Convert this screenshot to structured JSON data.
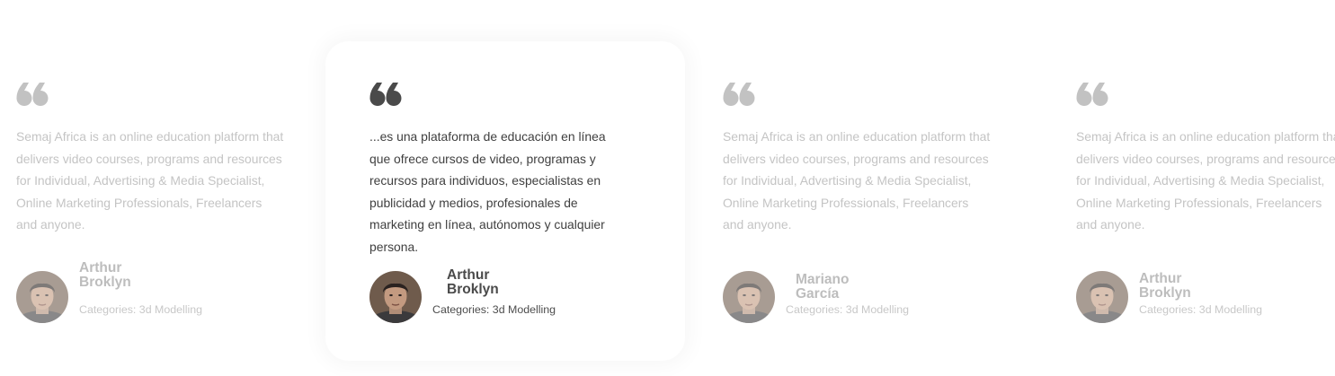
{
  "testimonials": [
    {
      "text": "Semaj Africa is an online education platform that delivers video courses, programs and resources for Individual, Advertising & Media Specialist, Online Marketing Professionals, Freelancers and anyone.",
      "name_line1": "Arthur",
      "name_line2": "Broklyn",
      "category": "Categories: 3d Modelling",
      "state": "faded"
    },
    {
      "text": "...es una plataforma de educación en línea que ofrece cursos de video, programas y recursos para individuos, especialistas en publicidad y medios, profesionales de marketing en línea, autónomos y cualquier persona.",
      "name_line1": "Arthur",
      "name_line2": "Broklyn",
      "category": "Categories: 3d Modelling",
      "state": "active"
    },
    {
      "text": "Semaj Africa is an online education platform that delivers video courses, programs and resources for Individual, Advertising & Media Specialist, Online Marketing Professionals, Freelancers and anyone.",
      "name_line1": "Mariano",
      "name_line2": "García",
      "category": "Categories: 3d Modelling",
      "state": "faded"
    },
    {
      "text": "Semaj Africa is an online education platform that delivers video courses, programs and resources for Individual, Advertising & Media Specialist, Online Marketing Professionals, Freelancers and anyone.",
      "name_line1": "Arthur",
      "name_line2": "Broklyn",
      "category": "Categories: 3d Modelling",
      "state": "faded"
    }
  ],
  "colors": {
    "quote_faded": "#c2c2c2",
    "quote_active": "#4a4a4a"
  },
  "icons": {
    "quote": "quote-icon",
    "avatar": "avatar-photo"
  }
}
